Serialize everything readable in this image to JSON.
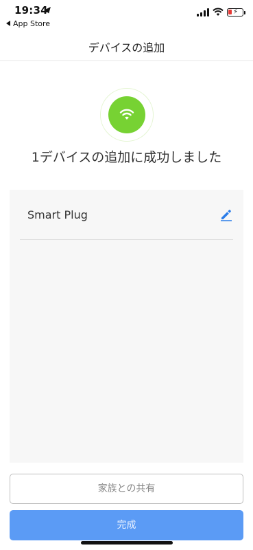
{
  "status_bar": {
    "time": "19:34",
    "back_app": "App Store"
  },
  "nav": {
    "title": "デバイスの追加"
  },
  "success": {
    "message": "1デバイスの追加に成功しました",
    "icon": "wifi-icon",
    "icon_color": "#77d233"
  },
  "devices": [
    {
      "name": "Smart Plug",
      "action_icon": "edit-pencil-icon"
    }
  ],
  "buttons": {
    "share_label": "家族との共有",
    "done_label": "完成",
    "done_color": "#5b9bf5"
  }
}
